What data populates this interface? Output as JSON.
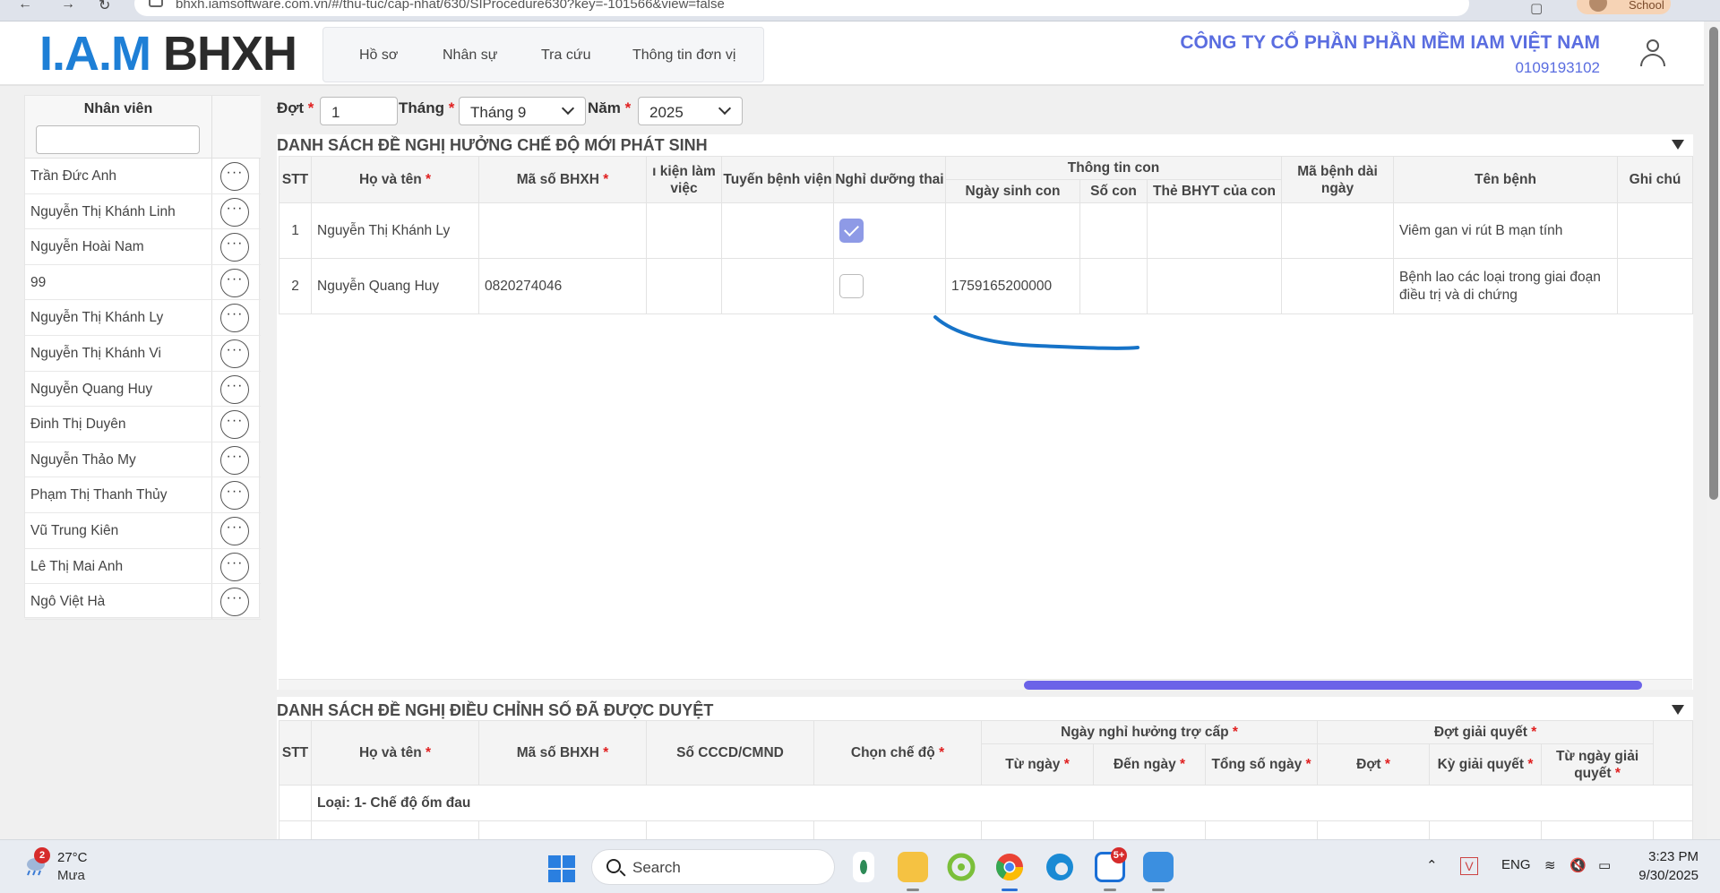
{
  "browser": {
    "url": "bhxh.iamsoftware.com.vn/#/thu-tuc/cap-nhat/630/SIProcedure630?key=-101566&view=false",
    "profile": "School"
  },
  "header": {
    "logo_part1": "I.A.M",
    "logo_part2": "BHXH",
    "menu": [
      "Hồ sơ",
      "Nhân sự",
      "Tra cứu",
      "Thông tin đơn vị"
    ],
    "company": "CÔNG TY CỔ PHẦN PHẦN MỀM IAM VIỆT NAM",
    "tax_code": "0109193102"
  },
  "sidebar": {
    "title": "Nhân viên",
    "more_label": "···",
    "employees": [
      "Trần Đức Anh",
      "Nguyễn Thị Khánh Linh",
      "Nguyễn Hoài Nam",
      "99",
      "Nguyễn Thị Khánh Ly",
      "Nguyễn Thị Khánh Vi",
      "Nguyễn Quang Huy",
      "Đinh Thị Duyên",
      "Nguyễn Thảo My",
      "Phạm Thị Thanh Thủy",
      "Vũ Trung Kiên",
      "Lê Thị Mai Anh",
      "Ngô Việt Hà"
    ]
  },
  "filters": {
    "dot_label": "Đợt",
    "dot_value": "1",
    "thang_label": "Tháng",
    "thang_value": "Tháng 9",
    "nam_label": "Năm",
    "nam_value": "2025",
    "required_mark": "*"
  },
  "section1": {
    "title": "DANH SÁCH ĐỀ NGHỊ HƯỞNG CHẾ ĐỘ MỚI PHÁT SINH",
    "headers": {
      "stt": "STT",
      "ho_ten": "Họ và tên",
      "ma_bhxh": "Mã số BHXH",
      "dieu_kien": "ı kiện làm việc",
      "tuyen_bv": "Tuyến bệnh viện",
      "nghi_duong_thai": "Nghỉ dưỡng thai",
      "thong_tin_con": "Thông tin con",
      "ngay_sinh_con": "Ngày sinh con",
      "so_con": "Số con",
      "the_bhyt": "Thẻ BHYT của con",
      "ma_benh": "Mã bệnh dài ngày",
      "ten_benh": "Tên bệnh",
      "ghi_chu": "Ghi chú"
    },
    "rows": [
      {
        "stt": "1",
        "ho_ten": "Nguyễn Thị Khánh Ly",
        "ma_bhxh": "",
        "nghi_duong_thai": true,
        "ngay_sinh_con": "",
        "ten_benh": "Viêm gan vi rút B mạn tính"
      },
      {
        "stt": "2",
        "ho_ten": "Nguyễn Quang Huy",
        "ma_bhxh": "0820274046",
        "nghi_duong_thai": false,
        "ngay_sinh_con": "1759165200000",
        "ten_benh_line1": "Bệnh lao các loại trong giai đoạn",
        "ten_benh_line2": "điều trị và di chứng"
      }
    ]
  },
  "section2": {
    "title": "DANH SÁCH ĐỀ NGHỊ ĐIỀU CHỈNH SỐ ĐÃ ĐƯỢC DUYỆT",
    "headers": {
      "stt": "STT",
      "ho_ten": "Họ và tên",
      "ma_bhxh": "Mã số BHXH",
      "cccd": "Số CCCD/CMND",
      "che_do": "Chọn chế độ",
      "ngay_nghi": "Ngày nghỉ hưởng trợ cấp",
      "tu_ngay": "Từ ngày",
      "den_ngay": "Đến ngày",
      "tong_so_ngay": "Tổng số ngày",
      "dot_giai_quyet": "Đợt giải quyết",
      "dot": "Đợt",
      "ky_giai_quyet": "Kỳ giải quyết",
      "tu_ngay_gq": "Từ ngày giải quyết"
    },
    "group_label": "Loại: 1- Chế độ ốm đau"
  },
  "taskbar": {
    "weather_badge": "2",
    "temperature": "27°C",
    "condition": "Mưa",
    "search": "Search",
    "zalo_badge": "5+",
    "language": "ENG",
    "time": "3:23 PM",
    "date": "9/30/2025"
  }
}
